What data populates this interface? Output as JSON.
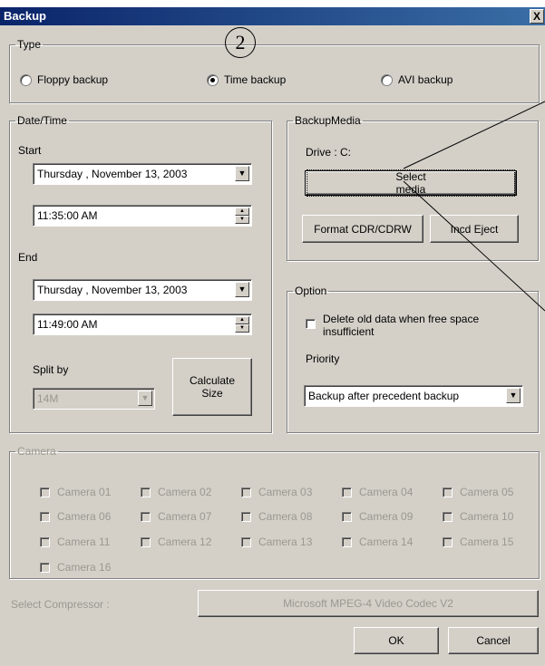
{
  "window": {
    "title": "Backup",
    "close_glyph": "X"
  },
  "callout": "2",
  "type_group": {
    "label": "Type",
    "options": [
      {
        "label": "Floppy backup",
        "selected": false
      },
      {
        "label": "Time backup",
        "selected": true
      },
      {
        "label": "AVI backup",
        "selected": false
      }
    ]
  },
  "datetime": {
    "label": "Date/Time",
    "start_label": "Start",
    "start_date": "Thursday  , November 13, 2003",
    "start_time": "11:35:00 AM",
    "end_label": "End",
    "end_date": "Thursday  , November 13, 2003",
    "end_time": "11:49:00 AM",
    "split_label": "Split by",
    "split_value": "14M",
    "calc_line1": "Calculate",
    "calc_line2": "Size"
  },
  "media": {
    "label": "BackupMedia",
    "drive": "Drive : C:",
    "select_media": "Select media",
    "format": "Format CDR/CDRW",
    "eject": "Incd Eject"
  },
  "option": {
    "label": "Option",
    "delete_old_line1": "Delete old data when free space",
    "delete_old_line2": "insufficient",
    "priority_label": "Priority",
    "priority_value": "Backup after precedent backup"
  },
  "camera": {
    "label": "Camera",
    "cameras": [
      "Camera 01",
      "Camera 02",
      "Camera 03",
      "Camera 04",
      "Camera 05",
      "Camera 06",
      "Camera 07",
      "Camera 08",
      "Camera 09",
      "Camera 10",
      "Camera 11",
      "Camera 12",
      "Camera 13",
      "Camera 14",
      "Camera 15",
      "Camera 16"
    ]
  },
  "compressor": {
    "label": "Select Compressor :",
    "value": "Microsoft MPEG-4 Video Codec V2"
  },
  "buttons": {
    "ok": "OK",
    "cancel": "Cancel"
  },
  "glyphs": {
    "dropdown": "▼",
    "spin_up": "▲",
    "spin_down": "▼"
  }
}
